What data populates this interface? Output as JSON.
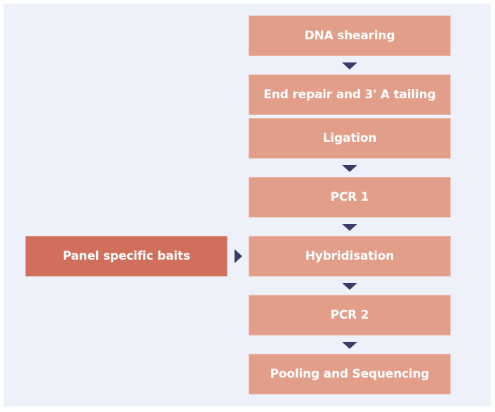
{
  "diagram": {
    "type": "flowchart",
    "steps": [
      {
        "label": "DNA shearing"
      },
      {
        "label": "End repair and 3' A tailing"
      },
      {
        "label": "Ligation"
      },
      {
        "label": "PCR 1"
      },
      {
        "label": "Hybridisation"
      },
      {
        "label": "PCR 2"
      },
      {
        "label": "Pooling and Sequencing"
      }
    ],
    "side_input": {
      "label": "Panel specific baits",
      "feeds_into": "Hybridisation"
    },
    "connectors": [
      {
        "from": "DNA shearing",
        "to": "End repair and 3' A tailing",
        "icon": "arrow-down-icon"
      },
      {
        "from": "Ligation",
        "to": "PCR 1",
        "icon": "arrow-down-icon"
      },
      {
        "from": "PCR 1",
        "to": "Hybridisation",
        "icon": "arrow-down-icon"
      },
      {
        "from": "Hybridisation",
        "to": "PCR 2",
        "icon": "arrow-down-icon"
      },
      {
        "from": "PCR 2",
        "to": "Pooling and Sequencing",
        "icon": "arrow-down-icon"
      },
      {
        "from": "Panel specific baits",
        "to": "Hybridisation",
        "icon": "arrow-right-icon"
      }
    ],
    "colors": {
      "background": "#eef0fa",
      "step_box": "#e39e8a",
      "side_box": "#cf6f5c",
      "arrow": "#393c69",
      "text": "#ffffff"
    }
  }
}
